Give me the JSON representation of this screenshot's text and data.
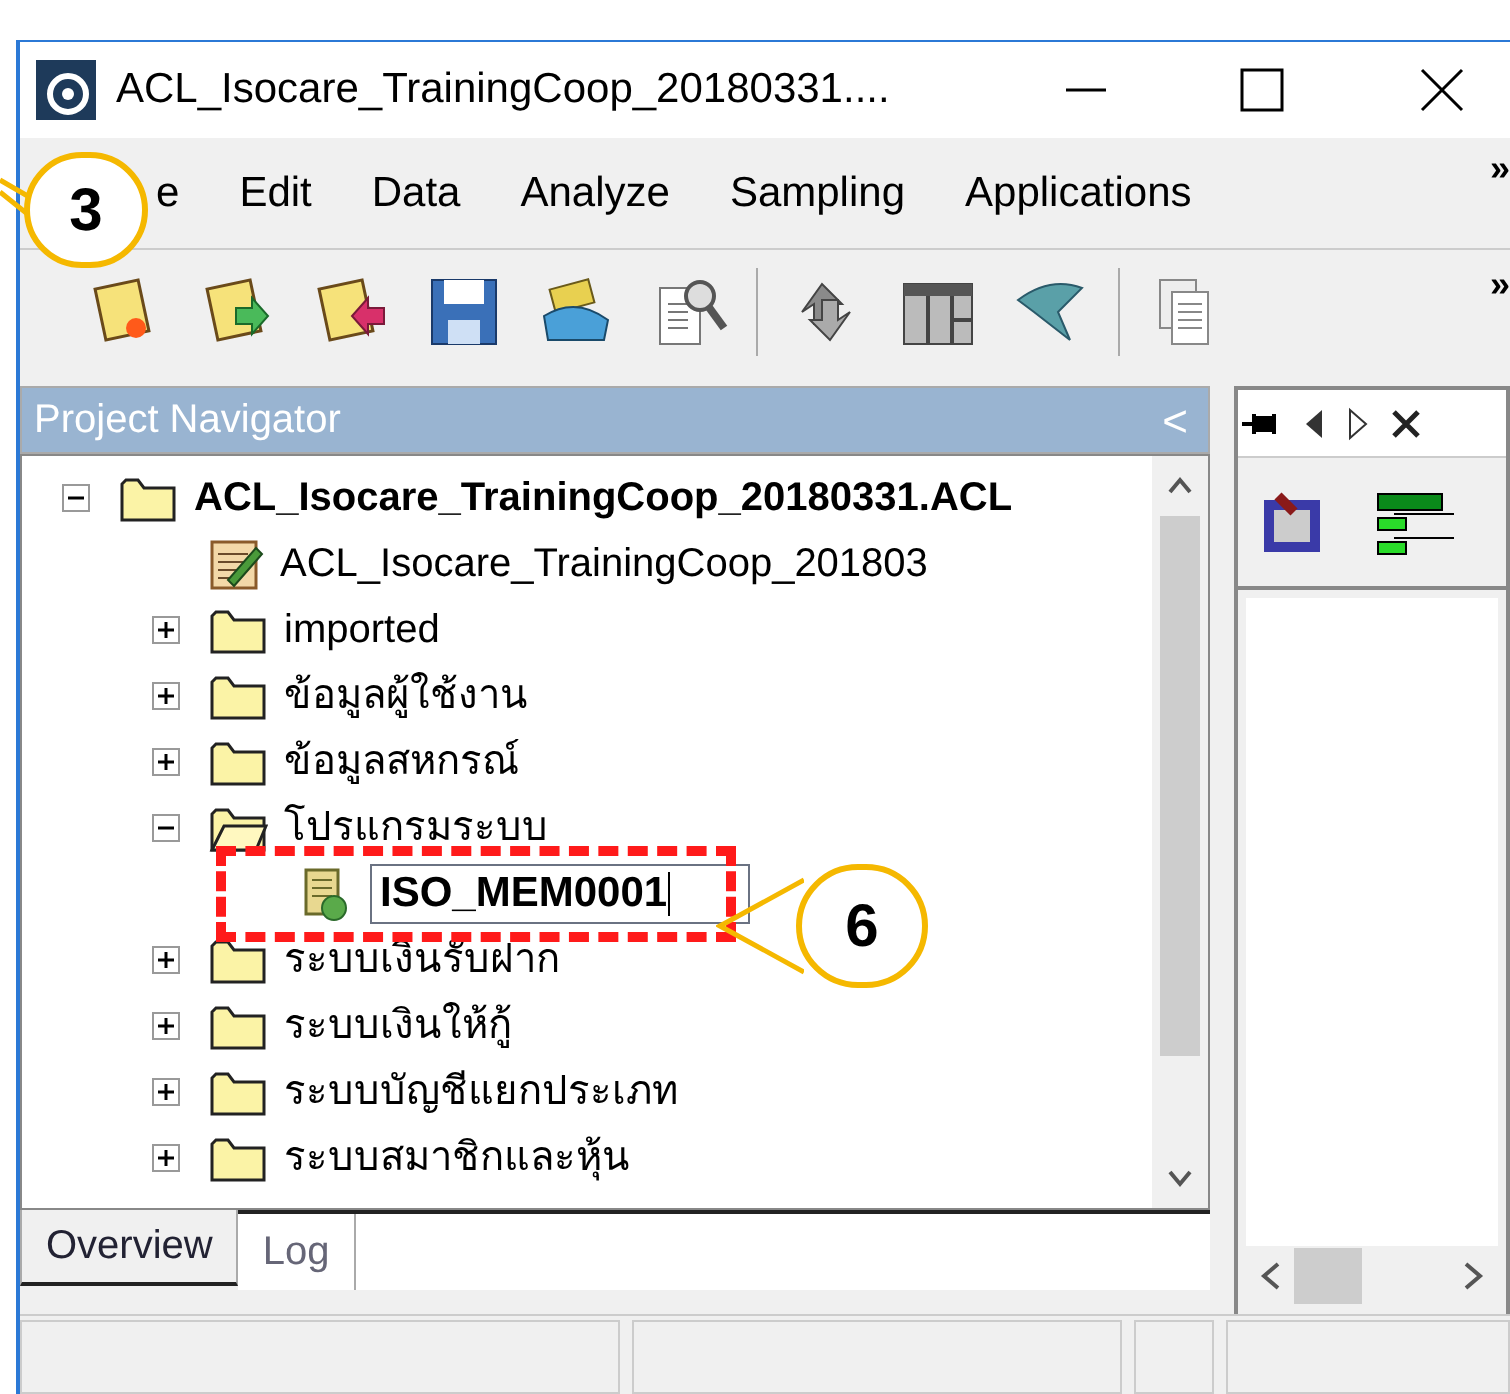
{
  "window": {
    "title": "ACL_Isocare_TrainingCoop_20180331...."
  },
  "menu": {
    "items": [
      {
        "label": "e"
      },
      {
        "label": "Edit"
      },
      {
        "label": "Data"
      },
      {
        "label": "Analyze"
      },
      {
        "label": "Sampling"
      },
      {
        "label": "Applications"
      }
    ],
    "overflow": "»"
  },
  "toolbar": {
    "overflow": "»"
  },
  "navigator": {
    "title": "Project Navigator",
    "collapse": "<",
    "tree": [
      {
        "kind": "project",
        "label": "ACL_Isocare_TrainingCoop_20180331.ACL",
        "expanded": true,
        "children": [
          {
            "kind": "script",
            "label": "ACL_Isocare_TrainingCoop_201803"
          },
          {
            "kind": "folder",
            "label": "imported",
            "expanded": false
          },
          {
            "kind": "folder",
            "label": "ข้อมูลผู้ใช้งาน",
            "expanded": false
          },
          {
            "kind": "folder",
            "label": "ข้อมูลสหกรณ์",
            "expanded": false
          },
          {
            "kind": "folder",
            "label": "โปรแกรมระบบ",
            "expanded": true,
            "children": [
              {
                "kind": "table",
                "label": "ISO_MEM0001",
                "editing": true
              }
            ]
          },
          {
            "kind": "folder",
            "label": "ระบบเงินรับฝาก",
            "expanded": false
          },
          {
            "kind": "folder",
            "label": "ระบบเงินให้กู้",
            "expanded": false
          },
          {
            "kind": "folder",
            "label": "ระบบบัญชีแยกประเภท",
            "expanded": false
          },
          {
            "kind": "folder",
            "label": "ระบบสมาชิกและหุ้น",
            "expanded": false
          }
        ]
      }
    ]
  },
  "tabs": [
    {
      "label": "Overview",
      "selected": true
    },
    {
      "label": "Log",
      "selected": false
    }
  ],
  "callouts": [
    {
      "label": "3"
    },
    {
      "label": "6"
    }
  ]
}
